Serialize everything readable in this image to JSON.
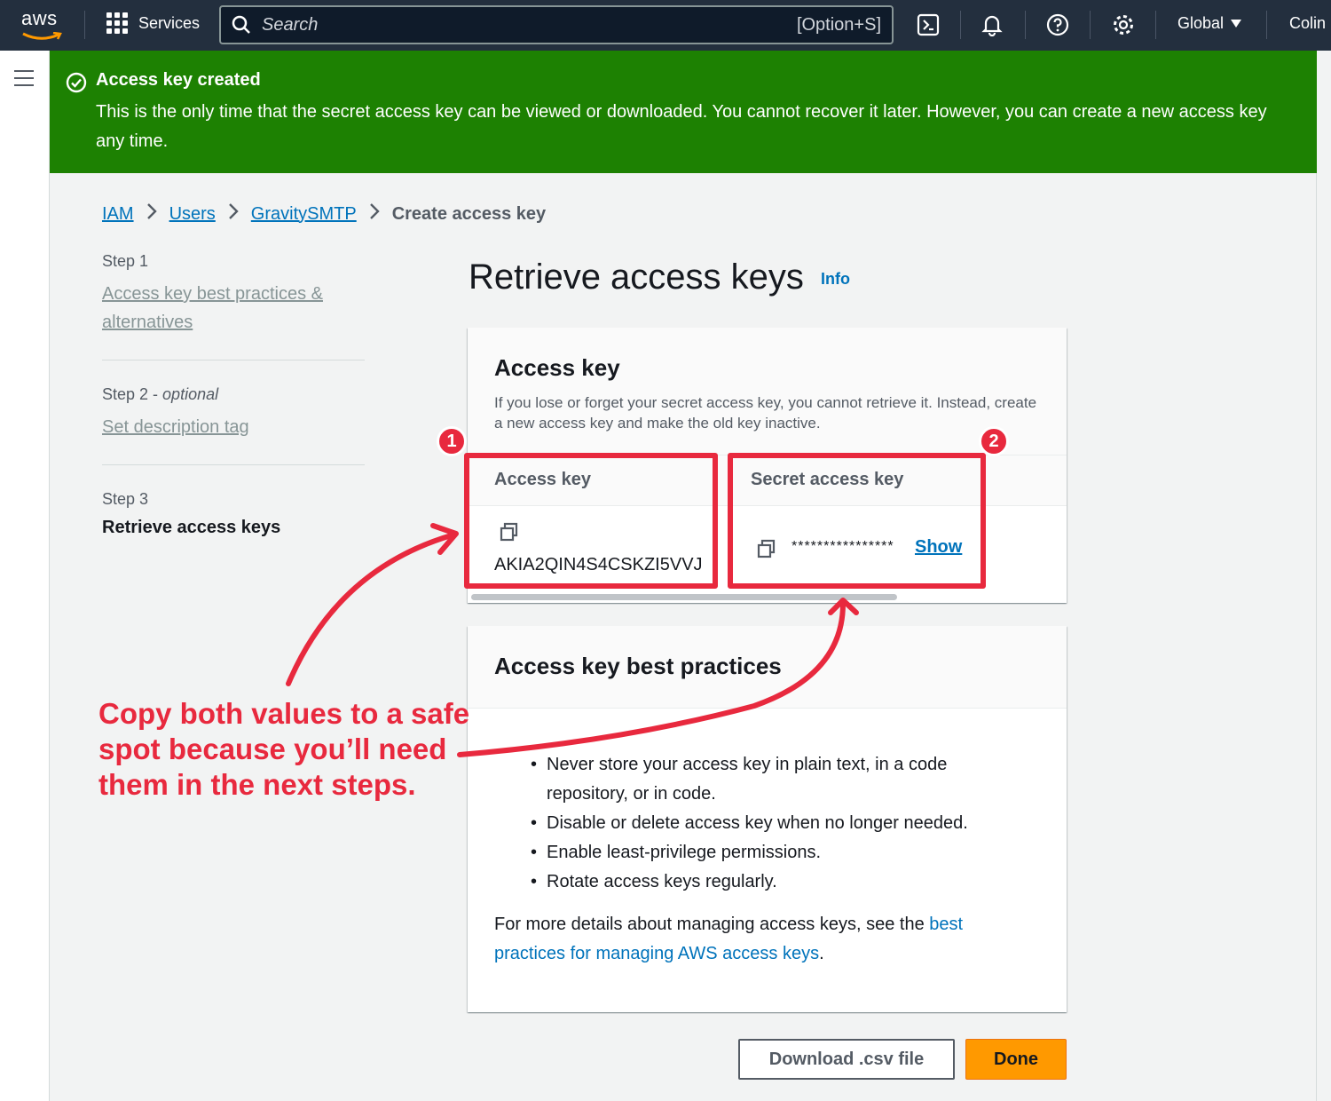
{
  "topnav": {
    "logo_text": "aws",
    "services_label": "Services",
    "search_placeholder": "Search",
    "search_shortcut": "[Option+S]",
    "region_label": "Global",
    "user_label": "Colin",
    "icons": [
      "grid-icon",
      "search-icon",
      "cloudshell-icon",
      "bell-icon",
      "help-icon",
      "gear-icon",
      "caret-down-icon"
    ]
  },
  "flash": {
    "title": "Access key created",
    "message": "This is the only time that the secret access key can be viewed or downloaded. You cannot recover it later. However, you can create a new access key any time."
  },
  "breadcrumb": {
    "items": [
      "IAM",
      "Users",
      "GravitySMTP"
    ],
    "current": "Create access key"
  },
  "steps": {
    "step1_label": "Step 1",
    "step1_title": "Access key best practices & alternatives",
    "step2_label": "Step 2 - ",
    "step2_optional": "optional",
    "step2_title": "Set description tag",
    "step3_label": "Step 3",
    "step3_title": "Retrieve access keys"
  },
  "page": {
    "title": "Retrieve access keys",
    "info_link": "Info"
  },
  "access_key_card": {
    "title": "Access key",
    "description": "If you lose or forget your secret access key, you cannot retrieve it. Instead, create a new access key and make the old key inactive.",
    "col_access_key": "Access key",
    "col_secret_key": "Secret access key",
    "access_key_value": "AKIA2QIN4S4CSKZI5VVJ",
    "secret_masked": "****************",
    "show_label": "Show"
  },
  "best_practices_card": {
    "title": "Access key best practices",
    "items": [
      "Never store your access key in plain text, in a code repository, or in code.",
      "Disable or delete access key when no longer needed.",
      "Enable least-privilege permissions.",
      "Rotate access keys regularly."
    ],
    "more_prefix": "For more details about managing access keys, see the ",
    "more_link": "best practices for managing AWS access keys",
    "more_suffix": "."
  },
  "buttons": {
    "download": "Download .csv file",
    "done": "Done"
  },
  "annotations": {
    "badge1": "1",
    "badge2": "2",
    "callout": "Copy both values to a safe spot because you’ll need them in the next steps."
  },
  "colors": {
    "nav_bg": "#232f3e",
    "flash_green": "#1d8102",
    "link_blue": "#0073bb",
    "primary_orange": "#ff9900",
    "annotation_red": "#e8293e"
  }
}
